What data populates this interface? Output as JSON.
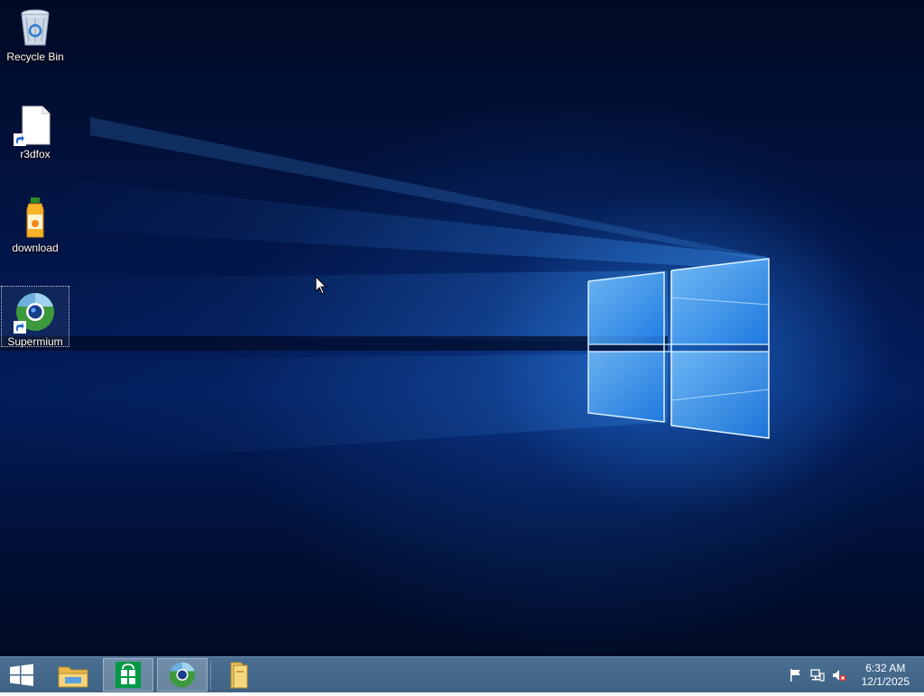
{
  "desktop": {
    "icons": [
      {
        "label": "Recycle Bin",
        "icon": "recycle-bin-icon"
      },
      {
        "label": "r3dfox",
        "icon": "blank-file-shortcut-icon"
      },
      {
        "label": "download",
        "icon": "juice-bottle-icon"
      },
      {
        "label": "Supermium",
        "icon": "supermium-browser-icon"
      }
    ]
  },
  "taskbar": {
    "buttons": [
      {
        "name": "start",
        "icon": "windows-logo-icon"
      },
      {
        "name": "file-explorer",
        "icon": "file-explorer-icon"
      },
      {
        "name": "store",
        "icon": "store-icon"
      },
      {
        "name": "supermium",
        "icon": "supermium-browser-icon"
      },
      {
        "name": "folder",
        "icon": "folder-icon"
      }
    ],
    "tray": {
      "icons": [
        "action-center-flag-icon",
        "network-icon",
        "volume-muted-icon"
      ],
      "time": "6:32 AM",
      "date": "12/1/2025"
    }
  },
  "colors": {
    "taskbar": "#426685",
    "wallpaper_glow": "#2a8cf0",
    "store_green": "#009a44"
  }
}
